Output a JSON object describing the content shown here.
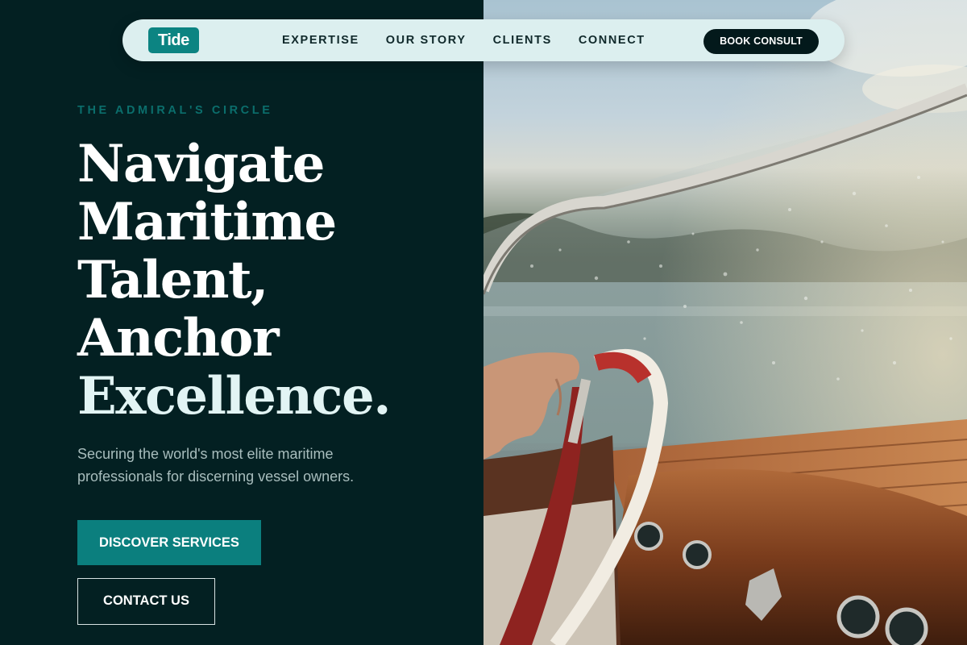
{
  "nav": {
    "logo": "Tide",
    "links": [
      "EXPERTISE",
      "OUR STORY",
      "CLIENTS",
      "CONNECT"
    ],
    "cta": "BOOK CONSULT"
  },
  "hero": {
    "eyebrow": "THE ADMIRAL'S CIRCLE",
    "headline_lines": [
      "Navigate",
      "Maritime",
      "Talent,",
      "Anchor",
      "Excellence."
    ],
    "subtitle": "Securing the world's most elite maritime professionals for discerning vessel owners.",
    "primary_button": "DISCOVER SERVICES",
    "secondary_button": "CONTACT US"
  },
  "image": {
    "description": "Hand on the red steering wheel of a wooden motorboat behind a wet windshield"
  },
  "colors": {
    "panel": "#032022",
    "accent": "#0b7f7e",
    "nav_bg": "#dcefef"
  }
}
